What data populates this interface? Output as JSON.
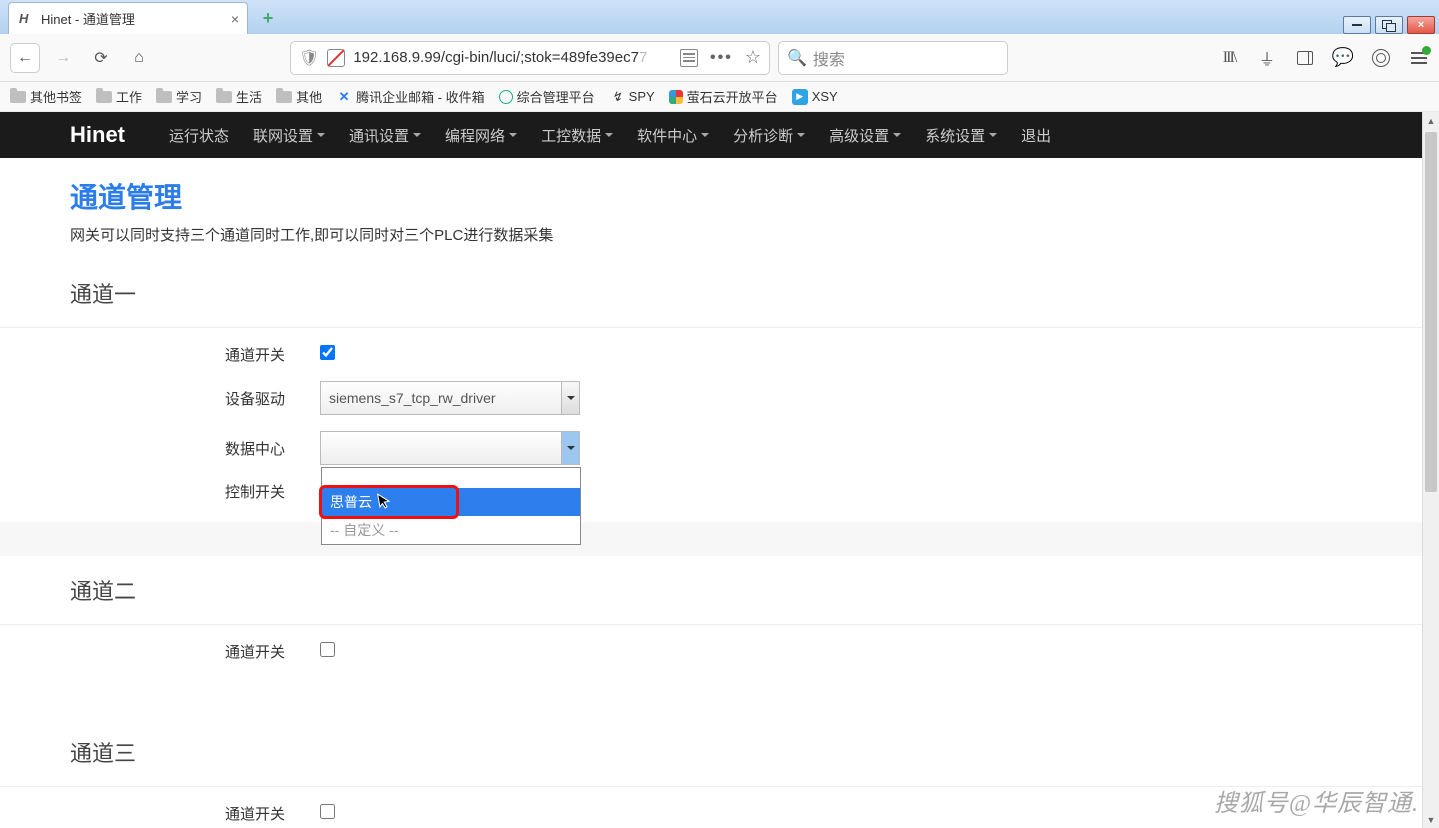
{
  "browser": {
    "tab_title": "Hinet - 通道管理",
    "url_plain": "192.168.9.99/cgi-bin/luci/;stok=489fe39ec7",
    "url_fade": "7",
    "search_placeholder": "搜索"
  },
  "bookmarks": [
    {
      "label": "其他书签",
      "type": "folder"
    },
    {
      "label": "工作",
      "type": "folder"
    },
    {
      "label": "学习",
      "type": "folder"
    },
    {
      "label": "生活",
      "type": "folder"
    },
    {
      "label": "其他",
      "type": "folder"
    },
    {
      "label": "腾讯企业邮箱 - 收件箱",
      "type": "link",
      "icon": "blue"
    },
    {
      "label": "综合管理平台",
      "type": "link",
      "icon": "green"
    },
    {
      "label": "SPY",
      "type": "link",
      "icon": "spy"
    },
    {
      "label": "萤石云开放平台",
      "type": "link",
      "icon": "ys"
    },
    {
      "label": "XSY",
      "type": "link",
      "icon": "xsy"
    }
  ],
  "appnav": {
    "brand": "Hinet",
    "items": [
      "运行状态",
      "联网设置",
      "通讯设置",
      "编程网络",
      "工控数据",
      "软件中心",
      "分析诊断",
      "高级设置",
      "系统设置",
      "退出"
    ],
    "dropdown_flags": [
      false,
      true,
      true,
      true,
      true,
      true,
      true,
      true,
      true,
      false
    ]
  },
  "page": {
    "title": "通道管理",
    "desc": "网关可以同时支持三个通道同时工作,即可以同时对三个PLC进行数据采集",
    "sections": [
      "通道一",
      "通道二",
      "通道三"
    ],
    "labels": {
      "ch_switch": "通道开关",
      "dev_driver": "设备驱动",
      "data_center": "数据中心",
      "ctrl_switch": "控制开关"
    },
    "driver_value": "siemens_s7_tcp_rw_driver",
    "dc_value": "",
    "dc_options": {
      "opt_hl": "思普云",
      "opt_custom": "-- 自定义 --"
    },
    "ch1_checked": true,
    "ch2_checked": false,
    "ch3_checked": false
  },
  "watermark": "搜狐号@华辰智通."
}
